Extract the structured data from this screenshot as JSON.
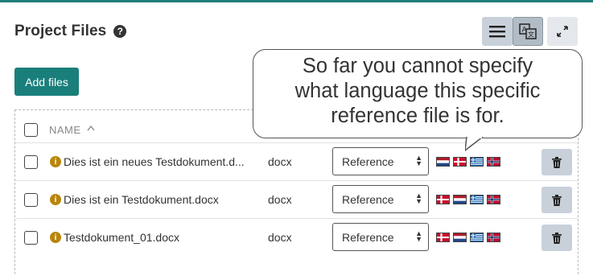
{
  "panel": {
    "title": "Project Files",
    "add_files_label": "Add files"
  },
  "table": {
    "name_header": "NAME",
    "rows": [
      {
        "name": "Dies ist ein neues Testdokument.d...",
        "ext": "docx",
        "type": "Reference",
        "flags": [
          "nl",
          "dk",
          "gr",
          "no"
        ]
      },
      {
        "name": "Dies ist ein Testdokument.docx",
        "ext": "docx",
        "type": "Reference",
        "flags": [
          "dk",
          "nl",
          "gr",
          "no"
        ]
      },
      {
        "name": "Testdokument_01.docx",
        "ext": "docx",
        "type": "Reference",
        "flags": [
          "dk",
          "nl",
          "gr",
          "no"
        ]
      }
    ]
  },
  "callout": {
    "lines": [
      "So far you cannot specify",
      "what language this specific",
      "reference file is for."
    ]
  },
  "colors": {
    "accent": "#1a7f7a",
    "button_gray": "#c8d1da",
    "info_icon": "#b8860b"
  },
  "icons": {
    "view_list": "hamburger-list-icon",
    "view_translate": "translate-icon",
    "view_expand": "expand-arrows-icon",
    "help": "question-circle-icon",
    "info": "info-circle-icon",
    "delete": "trash-icon",
    "sort": "chevron-up-icon"
  }
}
